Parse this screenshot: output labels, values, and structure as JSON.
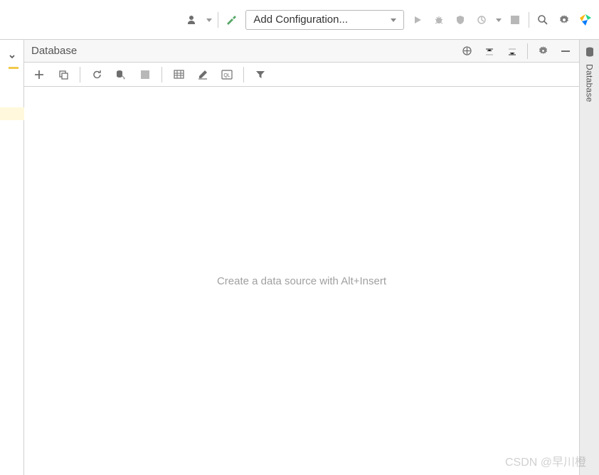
{
  "topbar": {
    "config_label": "Add Configuration..."
  },
  "panel": {
    "title": "Database",
    "empty_message": "Create a data source with Alt+Insert"
  },
  "rail": {
    "label": "Database"
  },
  "watermark": "CSDN @早川橙"
}
